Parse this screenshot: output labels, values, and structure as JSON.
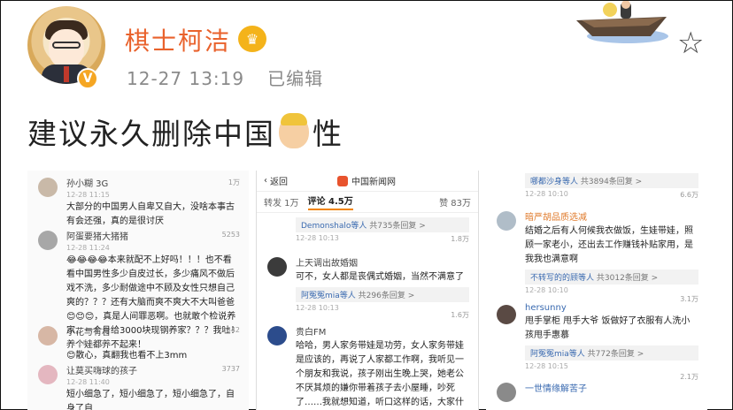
{
  "post": {
    "username": "棋士柯洁",
    "timestamp": "12-27 13:19",
    "edited": "已编辑",
    "text_before": "建议永久删除中国",
    "text_after": "性"
  },
  "shot1": {
    "comments": [
      {
        "name": "孙小糊 3G",
        "time": "12-28 11:15",
        "likes": "1万",
        "body": "大部分的中国男人自卑又自大，没啥本事古有会还强，真的是很讨厌"
      },
      {
        "name": "阿蛋要猪大猪猪",
        "time": "12-28 11:24",
        "likes": "5253",
        "body": "😂😂😂😂本来就配不上好吗！！！也不看看中国男性多少自皮过长，多少痛风不做后戏不洗，多少耐做途中不顾及女性只想自己爽的？？？还有大脑而爽不爽大不大叫爸爸😊😊😊，真是人间罪恶啊。也就敢个检说养家，一个月给3000块现钢养家？？？我吐！养个娃都养不起来！"
      },
      {
        "name": "小花与有言",
        "time": "12-28 11:35",
        "likes": "4342",
        "body": "😊散心，真翻我也看不上3mm"
      },
      {
        "name": "让莫买嗨球的孩子",
        "time": "12-28 11:40",
        "likes": "3737",
        "body": "短小细急了，短小细急了，短小细急了，自身了自"
      }
    ]
  },
  "shot2": {
    "back_label": "返回",
    "source": "中国新闻网",
    "tabs": {
      "repost": "转发 1万",
      "comment": "评论 4.5万",
      "likes": "赞 83万"
    },
    "comments": [
      {
        "sub_names": "Demonshalo等人",
        "sub_more": "共735条回复 >",
        "time": "12-28 10:13",
        "likes": "1.8万"
      },
      {
        "name": "上天调出故婚姻",
        "time": "",
        "likes": "",
        "body": "可不，女人都是丧偶式婚姻，当然不满意了",
        "sub_names": "阿冤冤mia等人",
        "sub_more": "共296条回复 >",
        "time2": "12-28 10:13",
        "likes2": "1.6万"
      },
      {
        "name": "贵白FM",
        "time": "",
        "likes": "",
        "body": "哈哈，男人家务带娃是功劳，女人家务带娃是应该的，再说了人家都工作啊，我听见一个朋友和我说，孩子刚出生晚上哭，她老公不厌其烦的嫌你带着孩子去小屋睡，吵死了……我就想知道，听口这样的话，大家什么好，我那女孩好"
      }
    ]
  },
  "shot3": {
    "comments": [
      {
        "sub_names": "哪都沙身等人",
        "sub_more": "共3894条回复 >",
        "time": "12-28 10:10",
        "likes": "6.6万"
      },
      {
        "name": "暗严胡品质选减",
        "time": "",
        "likes": "",
        "body": "结婚之后有人何候我衣做饭，生娃带娃，照顾一家老小，还出去工作赚钱补贴家用，是我我也满意啊",
        "sub_names": "不转写的的顾等人",
        "sub_more": "共3012条回复 >",
        "time2": "12-28 10:10",
        "likes2": "3.1万"
      },
      {
        "name": "hersunny",
        "time": "",
        "likes": "",
        "body": "甩手掌柜 甩手大爷 饭做好了衣服有人洗小孩甩手惠慕",
        "sub_names": "阿冤冤mia等人",
        "sub_more": "共772条回复 >",
        "time2": "12-28 10:15",
        "likes2": "2.1万"
      },
      {
        "name": "一世情缘解苦子",
        "time": "",
        "likes": "",
        "body": ""
      }
    ]
  }
}
